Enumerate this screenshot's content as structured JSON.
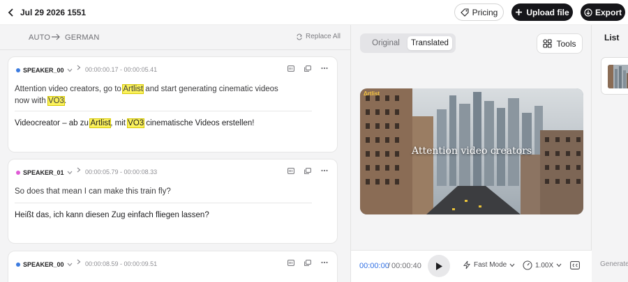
{
  "header": {
    "title": "Jul 29 2026 1551",
    "pricing_label": "Pricing",
    "upload_label": "Upload file",
    "export_label": "Export"
  },
  "lang_bar": {
    "source": "AUTO",
    "target": "GERMAN",
    "replace_all_label": "Replace All"
  },
  "segments": [
    {
      "speaker": "SPEAKER_00",
      "speaker_color": "#3b7be0",
      "time": "00:00:00.17 - 00:00:05.41",
      "source_parts": [
        "Attention video creators, go to ",
        "Artlist",
        " and start generating cinematic videos now with ",
        "VO3",
        "."
      ],
      "translation_parts": [
        "Videocreator – ab zu ",
        "Artlist",
        ", mit ",
        "VO3",
        " cinematische Videos erstellen!"
      ]
    },
    {
      "speaker": "SPEAKER_01",
      "speaker_color": "#e05ad6",
      "time": "00:00:05.79 - 00:00:08.33",
      "source": "So does that mean I can make this train fly?",
      "translation": "Heißt das, ich kann diesen Zug einfach fliegen lassen?"
    },
    {
      "speaker": "SPEAKER_00",
      "speaker_color": "#3b7be0",
      "time": "00:00:08.59 - 00:00:09.51"
    }
  ],
  "preview": {
    "toggle_original": "Original",
    "toggle_translated": "Translated",
    "tools_label": "Tools",
    "video_logo": "Δrtlist",
    "video_caption": "Attention video creators"
  },
  "player": {
    "current_time": "00:00:00",
    "separator": "/",
    "total_time": "00:00:40",
    "mode": "Fast Mode",
    "speed": "1.00X"
  },
  "right_panel": {
    "list_tab": "List",
    "generate_label": "Generate"
  },
  "colors": {
    "accent_blue": "#2f6fe4",
    "highlight": "#fbf25c",
    "dark_button": "#16161a"
  },
  "icons": [
    "chevron-left-icon",
    "tag-icon",
    "plus-icon",
    "download-icon",
    "replace-icon",
    "arrow-right-icon",
    "subtitle-icon",
    "copy-icon",
    "more-icon",
    "grid-icon",
    "play-icon",
    "bolt-icon",
    "speed-icon",
    "cc-icon"
  ]
}
